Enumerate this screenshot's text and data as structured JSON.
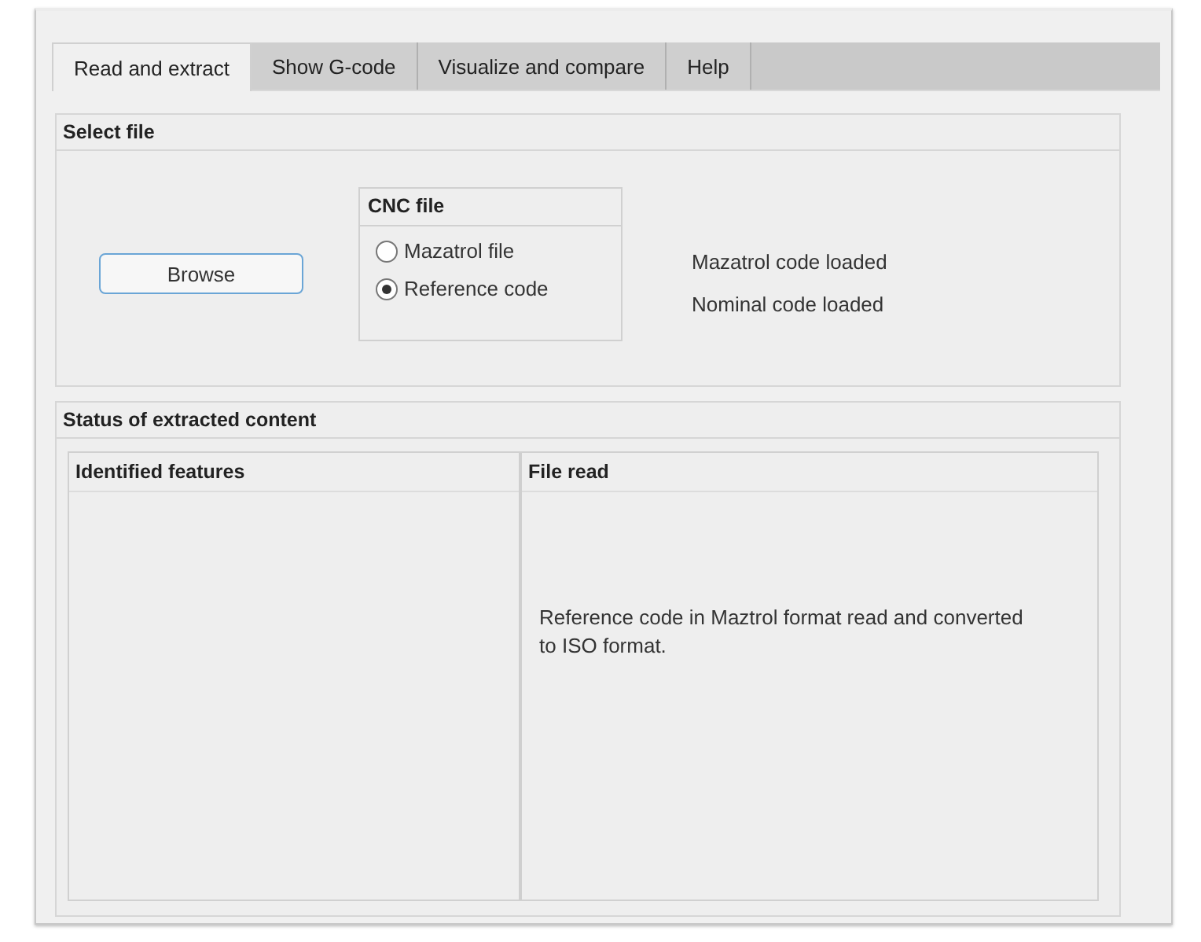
{
  "tabs": [
    {
      "label": "Read and extract",
      "selected": true
    },
    {
      "label": "Show G-code",
      "selected": false
    },
    {
      "label": "Visualize and compare",
      "selected": false
    },
    {
      "label": "Help",
      "selected": false
    }
  ],
  "select_file": {
    "title": "Select file",
    "browse_button": "Browse",
    "cnc_file": {
      "title": "CNC file",
      "options": [
        {
          "label": "Mazatrol file",
          "selected": false
        },
        {
          "label": "Reference code",
          "selected": true
        }
      ]
    },
    "status_messages": [
      "Mazatrol code loaded",
      "Nominal code loaded"
    ]
  },
  "status": {
    "title": "Status of extracted content",
    "identified_features": {
      "title": "Identified features"
    },
    "file_read": {
      "title": "File read",
      "text": "Reference code in Maztrol format read  and converted to ISO format."
    }
  }
}
